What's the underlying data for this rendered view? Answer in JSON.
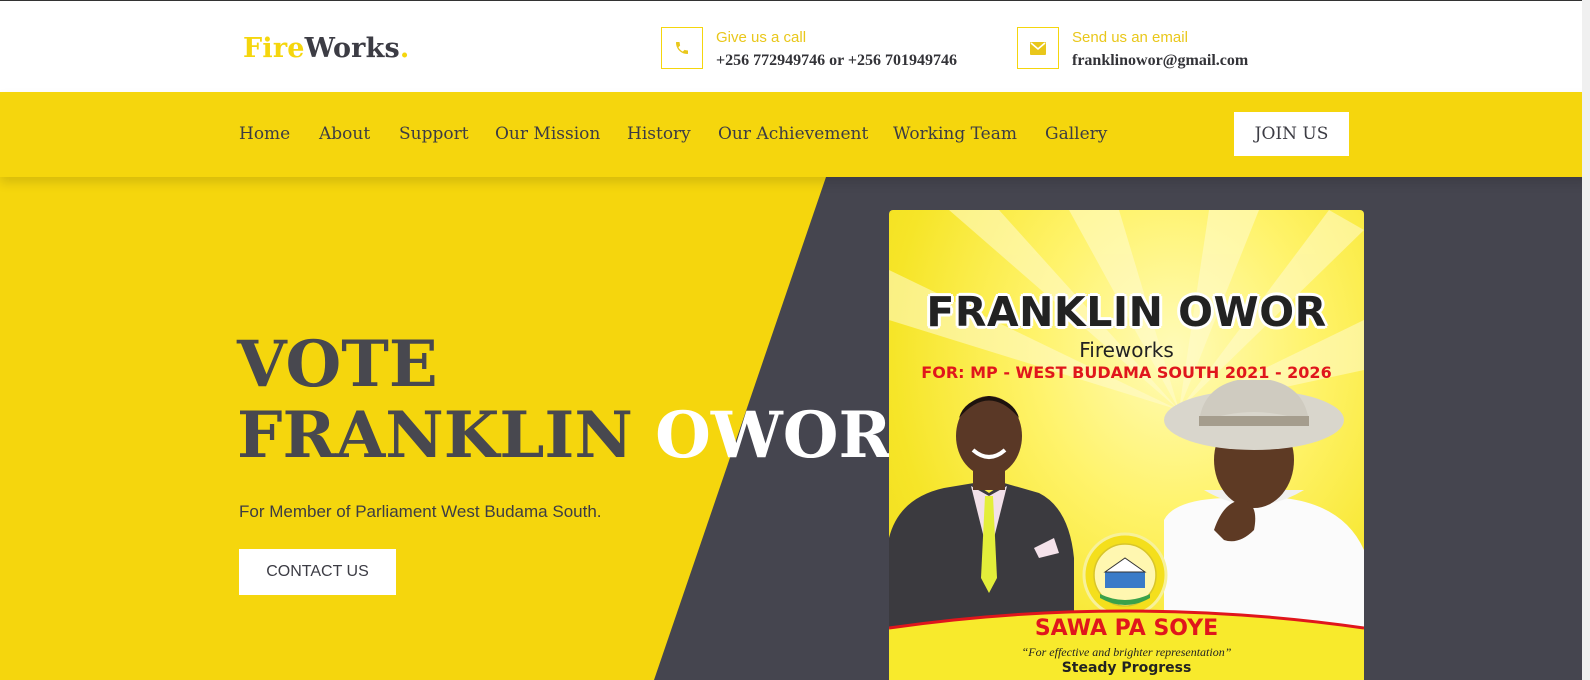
{
  "header": {
    "logo": {
      "part1": "Fire",
      "part2": "Works",
      "part3": "."
    },
    "call": {
      "label": "Give us a call",
      "value": "+256 772949746 or +256 701949746",
      "icon": "phone-icon"
    },
    "email": {
      "label": "Send us an email",
      "value": "franklinowor@gmail.com",
      "icon": "envelope-icon"
    }
  },
  "nav": {
    "items": [
      {
        "label": "Home"
      },
      {
        "label": "About"
      },
      {
        "label": "Support"
      },
      {
        "label": "Our Mission"
      },
      {
        "label": "History"
      },
      {
        "label": "Our Achievement"
      },
      {
        "label": "Working Team"
      },
      {
        "label": "Gallery"
      }
    ],
    "join_label": "JOIN US"
  },
  "hero": {
    "title_line1": "VOTE",
    "title_line2_a": "FRANKLIN ",
    "title_line2_b": "OWOR",
    "subtitle": "For Member of Parliament West Budama South.",
    "cta_label": "CONTACT US"
  },
  "poster": {
    "name": "FRANKLIN OWOR",
    "sub": "Fireworks",
    "for": "FOR: MP - WEST BUDAMA SOUTH 2021 - 2026",
    "slogan": "SAWA PA SOYE",
    "quote": "“For effective and brighter representation”",
    "tagline": "Steady Progress"
  },
  "colors": {
    "accent": "#f5d60d",
    "dark": "#45454f",
    "text": "#3c3c44",
    "poster_red": "#e0161c"
  }
}
